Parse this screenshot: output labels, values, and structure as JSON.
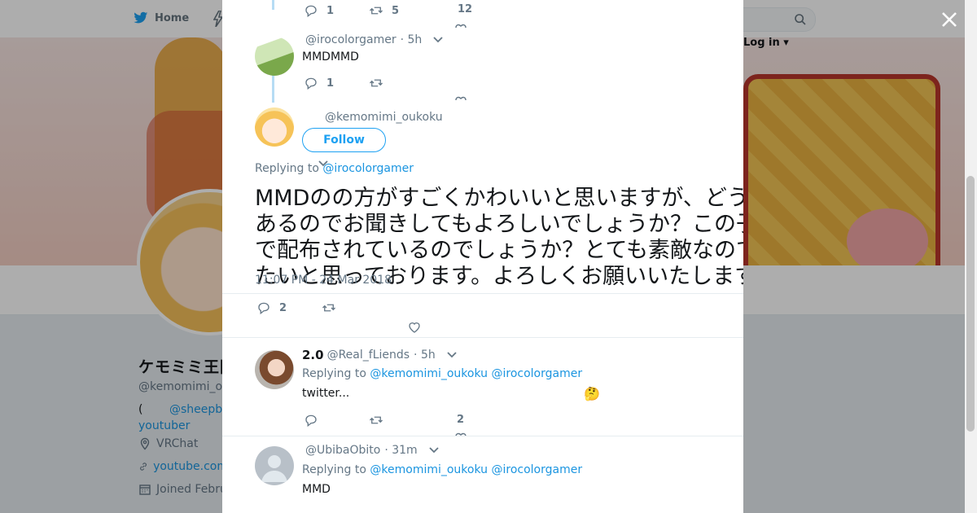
{
  "nav": {
    "home_label": "Home",
    "login_label": "Log in"
  },
  "profile": {
    "name": "ケモミミ王国",
    "handle": "@kemomimi_oukoku",
    "bio_prefix": "(",
    "bio_link": "@sheepb",
    "bio_line2": "youtuber",
    "location": "VRChat",
    "website": "youtube.com",
    "joined": "Joined Febru"
  },
  "tweets": [
    {
      "replies": "1",
      "retweets": "5",
      "likes": "12"
    },
    {
      "handle": "@irocolorgamer",
      "time": "· 5h",
      "text": "MMDMMD",
      "replies": "1"
    },
    {
      "handle": "@kemomimi_oukoku",
      "follow_label": "Follow",
      "replying_prefix": "Replying to",
      "replying_to": "@irocolorgamer",
      "text": "MMDのの方がすごくかわいいと思いますが、どうしても気になることがあるのでお聞きしてもよろしいでしょうか？この子たちのモデルはどちらで配布されているのでしょうか？とても素敵なのでぜひ使わせていただきたいと思っております。よろしくお願いいたします。",
      "timestamp": "11:07 PM - 24 Mar 2018",
      "replies": "2"
    },
    {
      "display_name": "2.0",
      "handle": "@Real_fLiends",
      "time": "· 5h",
      "replying_prefix": "Replying to",
      "replying_to_1": "@kemomimi_oukoku",
      "replying_to_2": "@irocolorgamer",
      "text": "twitter...",
      "emoji": "🤔",
      "likes": "2"
    },
    {
      "handle": "@UbibaObito",
      "time": "· 31m",
      "replying_prefix": "Replying to",
      "replying_to_1": "@kemomimi_oukoku",
      "replying_to_2": "@irocolorgamer",
      "text": "MMD"
    }
  ],
  "colors": {
    "link": "#1b95e0",
    "accent": "#1da1f2",
    "muted": "#657786",
    "thread": "#b6dcf4"
  },
  "icons": [
    "twitter-bird-icon",
    "search-icon",
    "close-icon",
    "reply-icon",
    "retweet-icon",
    "like-icon",
    "caret-down-icon",
    "location-icon",
    "link-icon",
    "calendar-icon"
  ]
}
